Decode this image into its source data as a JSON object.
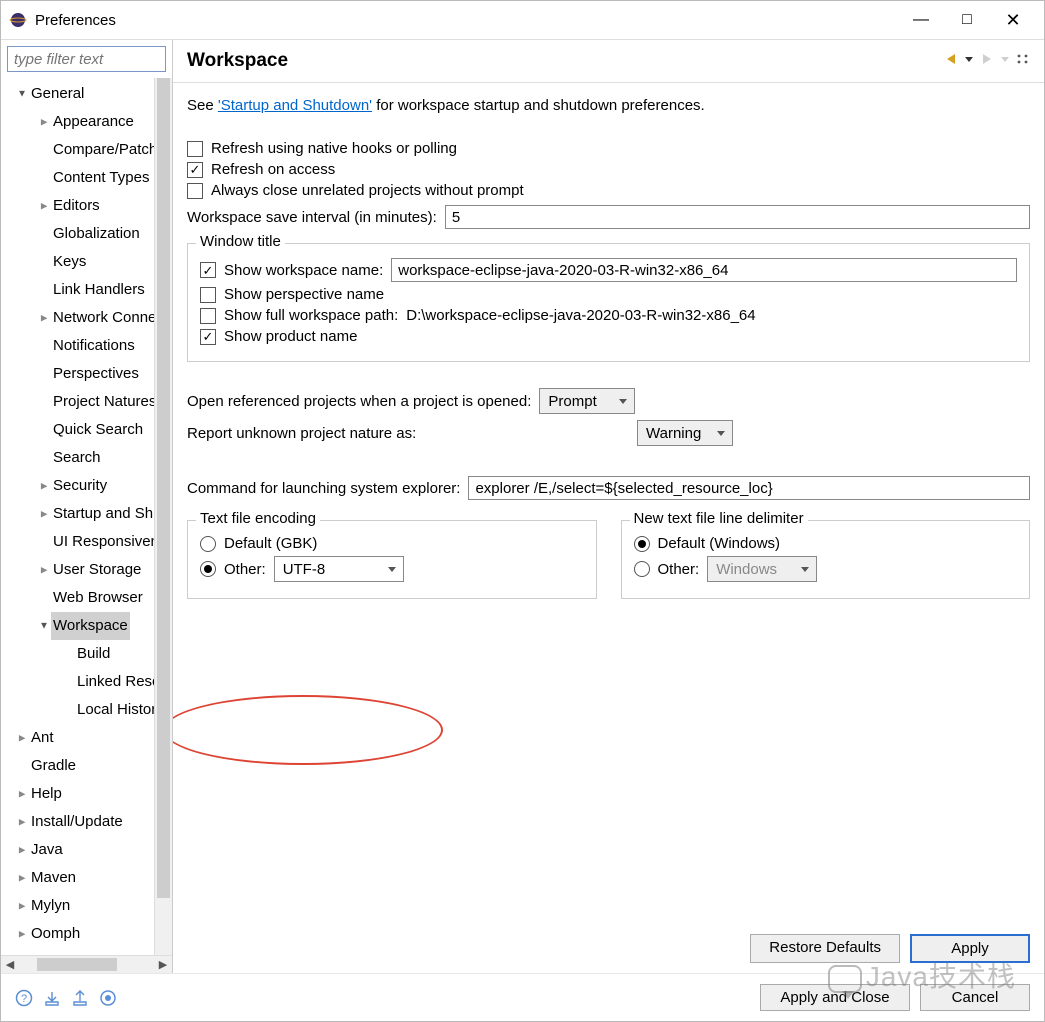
{
  "window": {
    "title": "Preferences"
  },
  "filter": {
    "placeholder": "type filter text"
  },
  "tree": {
    "items": [
      {
        "ind": 0,
        "tw": "v",
        "label": "General"
      },
      {
        "ind": 1,
        "tw": ">",
        "label": "Appearance"
      },
      {
        "ind": 1,
        "tw": "",
        "label": "Compare/Patch"
      },
      {
        "ind": 1,
        "tw": "",
        "label": "Content Types"
      },
      {
        "ind": 1,
        "tw": ">",
        "label": "Editors"
      },
      {
        "ind": 1,
        "tw": "",
        "label": "Globalization"
      },
      {
        "ind": 1,
        "tw": "",
        "label": "Keys"
      },
      {
        "ind": 1,
        "tw": "",
        "label": "Link Handlers"
      },
      {
        "ind": 1,
        "tw": ">",
        "label": "Network Connections"
      },
      {
        "ind": 1,
        "tw": "",
        "label": "Notifications"
      },
      {
        "ind": 1,
        "tw": "",
        "label": "Perspectives"
      },
      {
        "ind": 1,
        "tw": "",
        "label": "Project Natures"
      },
      {
        "ind": 1,
        "tw": "",
        "label": "Quick Search"
      },
      {
        "ind": 1,
        "tw": "",
        "label": "Search"
      },
      {
        "ind": 1,
        "tw": ">",
        "label": "Security"
      },
      {
        "ind": 1,
        "tw": ">",
        "label": "Startup and Shutdown"
      },
      {
        "ind": 1,
        "tw": "",
        "label": "UI Responsiveness"
      },
      {
        "ind": 1,
        "tw": ">",
        "label": "User Storage"
      },
      {
        "ind": 1,
        "tw": "",
        "label": "Web Browser"
      },
      {
        "ind": 1,
        "tw": "v",
        "label": "Workspace",
        "sel": true
      },
      {
        "ind": 2,
        "tw": "",
        "label": "Build"
      },
      {
        "ind": 2,
        "tw": "",
        "label": "Linked Resources"
      },
      {
        "ind": 2,
        "tw": "",
        "label": "Local History"
      },
      {
        "ind": 0,
        "tw": ">",
        "label": "Ant"
      },
      {
        "ind": 0,
        "tw": "",
        "label": "Gradle"
      },
      {
        "ind": 0,
        "tw": ">",
        "label": "Help"
      },
      {
        "ind": 0,
        "tw": ">",
        "label": "Install/Update"
      },
      {
        "ind": 0,
        "tw": ">",
        "label": "Java"
      },
      {
        "ind": 0,
        "tw": ">",
        "label": "Maven"
      },
      {
        "ind": 0,
        "tw": ">",
        "label": "Mylyn"
      },
      {
        "ind": 0,
        "tw": ">",
        "label": "Oomph"
      }
    ]
  },
  "page": {
    "title": "Workspace",
    "intro_pre": "See ",
    "intro_link": "'Startup and Shutdown'",
    "intro_post": " for workspace startup and shutdown preferences.",
    "chk_refresh_native": "Refresh using native hooks or polling",
    "chk_refresh_access": "Refresh on access",
    "chk_close_unrelated": "Always close unrelated projects without prompt",
    "save_interval_label": "Workspace save interval (in minutes):",
    "save_interval_value": "5",
    "window_title_legend": "Window title",
    "chk_show_ws_name": "Show workspace name:",
    "ws_name_value": "workspace-eclipse-java-2020-03-R-win32-x86_64",
    "chk_show_persp": "Show perspective name",
    "chk_show_full_path": "Show full workspace path:",
    "full_path_value": "D:\\workspace-eclipse-java-2020-03-R-win32-x86_64",
    "chk_show_product": "Show product name",
    "open_referenced_label": "Open referenced projects when a project is opened:",
    "open_referenced_value": "Prompt",
    "report_nature_label": "Report unknown project nature as:",
    "report_nature_value": "Warning",
    "explorer_cmd_label": "Command for launching system explorer:",
    "explorer_cmd_value": "explorer /E,/select=${selected_resource_loc}",
    "encoding_legend": "Text file encoding",
    "encoding_default": "Default (GBK)",
    "encoding_other": "Other:",
    "encoding_value": "UTF-8",
    "delim_legend": "New text file line delimiter",
    "delim_default": "Default (Windows)",
    "delim_other": "Other:",
    "delim_value": "Windows",
    "btn_restore": "Restore Defaults",
    "btn_apply": "Apply",
    "btn_apply_close": "Apply and Close",
    "btn_cancel": "Cancel"
  },
  "watermark": "Java技术栈"
}
